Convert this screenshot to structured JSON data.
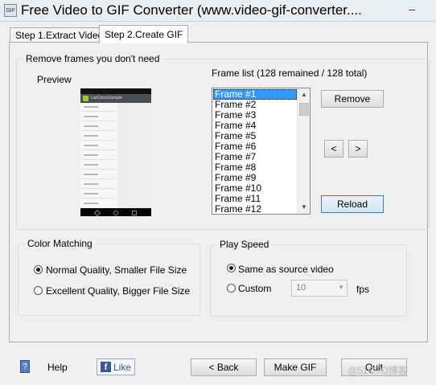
{
  "window": {
    "title": "Free Video to GIF Converter (www.video-gif-converter....",
    "app_icon": "GIF",
    "minimize": "–"
  },
  "tabs": [
    {
      "label": "Step 1.Extract Video",
      "active": false
    },
    {
      "label": "Step 2.Create GIF",
      "active": true
    }
  ],
  "remove_frames": {
    "title": "Remove frames you don't need",
    "preview_label": "Preview",
    "preview_bar_title": "ListCheckSample",
    "frame_list_label": "Frame list (128 remained / 128 total)",
    "frames": [
      "Frame #1",
      "Frame #2",
      "Frame #3",
      "Frame #4",
      "Frame #5",
      "Frame #6",
      "Frame #7",
      "Frame #8",
      "Frame #9",
      "Frame #10",
      "Frame #11",
      "Frame #12"
    ],
    "selected_index": 0,
    "remove_button": "Remove",
    "prev_button": "<",
    "next_button": ">",
    "reload_button": "Reload"
  },
  "color_matching": {
    "title": "Color Matching",
    "options": [
      "Normal Quality, Smaller File Size",
      "Excellent Quality, Bigger File Size"
    ],
    "selected": 0
  },
  "play_speed": {
    "title": "Play Speed",
    "options": [
      "Same as source video",
      "Custom"
    ],
    "selected": 0,
    "custom_value": "10",
    "unit": "fps"
  },
  "footer": {
    "help_icon": "?",
    "help_label": "Help",
    "like_label": "Like",
    "like_icon": "f",
    "back_button": "< Back",
    "make_gif_button": "Make GIF",
    "quit_button": "Quit",
    "watermark": "@51CTO博客"
  }
}
